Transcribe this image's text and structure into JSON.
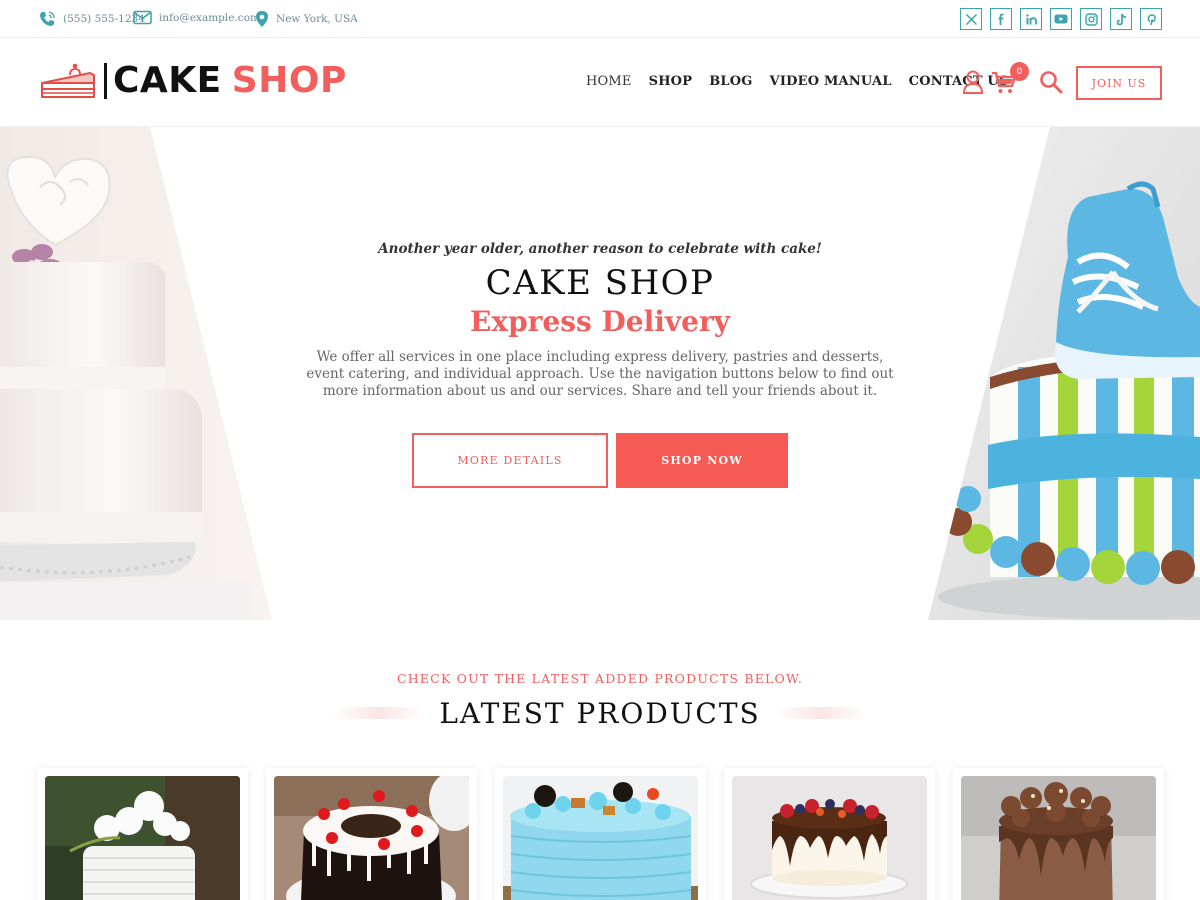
{
  "topbar": {
    "phone": "(555) 555-1234",
    "email": "info@example.com",
    "location": "New York, USA",
    "social_icons": [
      "x-icon",
      "facebook-icon",
      "linkedin-icon",
      "youtube-icon",
      "instagram-icon",
      "tiktok-icon",
      "pinterest-icon"
    ]
  },
  "header": {
    "logo_cake": "CAKE",
    "logo_shop": "SHOP",
    "nav": [
      "HOME",
      "SHOP",
      "BLOG",
      "VIDEO MANUAL",
      "CONTACT US"
    ],
    "cart_count": "0",
    "join_label": "JOIN US"
  },
  "hero": {
    "tagline": "Another year older, another reason to celebrate with cake!",
    "title": "CAKE SHOP",
    "subtitle": "Express Delivery",
    "description": "We offer all services in one place including express delivery, pastries and desserts, event catering, and individual approach. Use the navigation buttons below to find out more information about us and our services. Share and tell your friends about it.",
    "more_label": "MORE DETAILS",
    "shop_label": "SHOP NOW"
  },
  "products": {
    "kicker": "CHECK OUT THE LATEST ADDED PRODUCTS BELOW.",
    "title": "LATEST PRODUCTS"
  },
  "colors": {
    "accent": "#f15e5c",
    "teal": "#3fa3ad",
    "text_dark": "#111111"
  }
}
